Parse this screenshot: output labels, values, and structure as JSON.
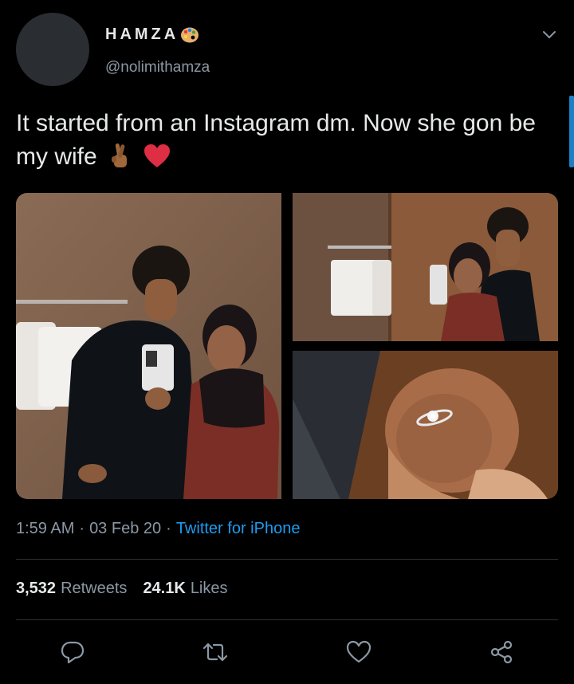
{
  "author": {
    "display_name": "HAMZA",
    "name_emoji": "palette-emoji",
    "handle": "@nolimithamza"
  },
  "tweet": {
    "text": "It started from an Instagram dm. Now she gon be my wife",
    "emojis": [
      "crossed-fingers-emoji",
      "red-heart-emoji"
    ]
  },
  "media": {
    "photos": [
      {
        "description": "mirror selfie, couple standing"
      },
      {
        "description": "mirror selfie, couple close"
      },
      {
        "description": "hand with engagement ring"
      }
    ]
  },
  "meta": {
    "time": "1:59 AM",
    "separator": "·",
    "date": "03 Feb 20",
    "source": "Twitter for iPhone"
  },
  "stats": {
    "retweets_count": "3,532",
    "retweets_label": "Retweets",
    "likes_count": "24.1K",
    "likes_label": "Likes"
  },
  "actions": {
    "icons": [
      "reply-icon",
      "retweet-icon",
      "like-icon",
      "share-icon"
    ]
  },
  "colors": {
    "background": "#000000",
    "text": "#e7e9ea",
    "secondary": "#8b98a5",
    "accent": "#1d9bf0",
    "divider": "#2f3336"
  }
}
